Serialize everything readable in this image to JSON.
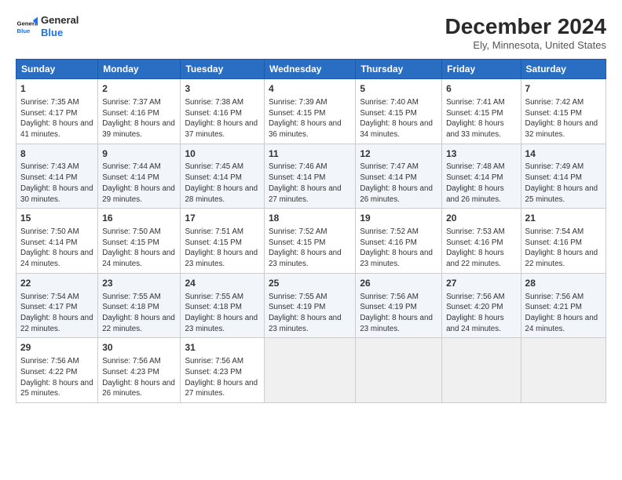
{
  "logo": {
    "line1": "General",
    "line2": "Blue"
  },
  "title": "December 2024",
  "location": "Ely, Minnesota, United States",
  "headers": [
    "Sunday",
    "Monday",
    "Tuesday",
    "Wednesday",
    "Thursday",
    "Friday",
    "Saturday"
  ],
  "weeks": [
    [
      {
        "day": "1",
        "sunrise": "7:35 AM",
        "sunset": "4:17 PM",
        "daylight": "8 hours and 41 minutes."
      },
      {
        "day": "2",
        "sunrise": "7:37 AM",
        "sunset": "4:16 PM",
        "daylight": "8 hours and 39 minutes."
      },
      {
        "day": "3",
        "sunrise": "7:38 AM",
        "sunset": "4:16 PM",
        "daylight": "8 hours and 37 minutes."
      },
      {
        "day": "4",
        "sunrise": "7:39 AM",
        "sunset": "4:15 PM",
        "daylight": "8 hours and 36 minutes."
      },
      {
        "day": "5",
        "sunrise": "7:40 AM",
        "sunset": "4:15 PM",
        "daylight": "8 hours and 34 minutes."
      },
      {
        "day": "6",
        "sunrise": "7:41 AM",
        "sunset": "4:15 PM",
        "daylight": "8 hours and 33 minutes."
      },
      {
        "day": "7",
        "sunrise": "7:42 AM",
        "sunset": "4:15 PM",
        "daylight": "8 hours and 32 minutes."
      }
    ],
    [
      {
        "day": "8",
        "sunrise": "7:43 AM",
        "sunset": "4:14 PM",
        "daylight": "8 hours and 30 minutes."
      },
      {
        "day": "9",
        "sunrise": "7:44 AM",
        "sunset": "4:14 PM",
        "daylight": "8 hours and 29 minutes."
      },
      {
        "day": "10",
        "sunrise": "7:45 AM",
        "sunset": "4:14 PM",
        "daylight": "8 hours and 28 minutes."
      },
      {
        "day": "11",
        "sunrise": "7:46 AM",
        "sunset": "4:14 PM",
        "daylight": "8 hours and 27 minutes."
      },
      {
        "day": "12",
        "sunrise": "7:47 AM",
        "sunset": "4:14 PM",
        "daylight": "8 hours and 26 minutes."
      },
      {
        "day": "13",
        "sunrise": "7:48 AM",
        "sunset": "4:14 PM",
        "daylight": "8 hours and 26 minutes."
      },
      {
        "day": "14",
        "sunrise": "7:49 AM",
        "sunset": "4:14 PM",
        "daylight": "8 hours and 25 minutes."
      }
    ],
    [
      {
        "day": "15",
        "sunrise": "7:50 AM",
        "sunset": "4:14 PM",
        "daylight": "8 hours and 24 minutes."
      },
      {
        "day": "16",
        "sunrise": "7:50 AM",
        "sunset": "4:15 PM",
        "daylight": "8 hours and 24 minutes."
      },
      {
        "day": "17",
        "sunrise": "7:51 AM",
        "sunset": "4:15 PM",
        "daylight": "8 hours and 23 minutes."
      },
      {
        "day": "18",
        "sunrise": "7:52 AM",
        "sunset": "4:15 PM",
        "daylight": "8 hours and 23 minutes."
      },
      {
        "day": "19",
        "sunrise": "7:52 AM",
        "sunset": "4:16 PM",
        "daylight": "8 hours and 23 minutes."
      },
      {
        "day": "20",
        "sunrise": "7:53 AM",
        "sunset": "4:16 PM",
        "daylight": "8 hours and 22 minutes."
      },
      {
        "day": "21",
        "sunrise": "7:54 AM",
        "sunset": "4:16 PM",
        "daylight": "8 hours and 22 minutes."
      }
    ],
    [
      {
        "day": "22",
        "sunrise": "7:54 AM",
        "sunset": "4:17 PM",
        "daylight": "8 hours and 22 minutes."
      },
      {
        "day": "23",
        "sunrise": "7:55 AM",
        "sunset": "4:18 PM",
        "daylight": "8 hours and 22 minutes."
      },
      {
        "day": "24",
        "sunrise": "7:55 AM",
        "sunset": "4:18 PM",
        "daylight": "8 hours and 23 minutes."
      },
      {
        "day": "25",
        "sunrise": "7:55 AM",
        "sunset": "4:19 PM",
        "daylight": "8 hours and 23 minutes."
      },
      {
        "day": "26",
        "sunrise": "7:56 AM",
        "sunset": "4:19 PM",
        "daylight": "8 hours and 23 minutes."
      },
      {
        "day": "27",
        "sunrise": "7:56 AM",
        "sunset": "4:20 PM",
        "daylight": "8 hours and 24 minutes."
      },
      {
        "day": "28",
        "sunrise": "7:56 AM",
        "sunset": "4:21 PM",
        "daylight": "8 hours and 24 minutes."
      }
    ],
    [
      {
        "day": "29",
        "sunrise": "7:56 AM",
        "sunset": "4:22 PM",
        "daylight": "8 hours and 25 minutes."
      },
      {
        "day": "30",
        "sunrise": "7:56 AM",
        "sunset": "4:23 PM",
        "daylight": "8 hours and 26 minutes."
      },
      {
        "day": "31",
        "sunrise": "7:56 AM",
        "sunset": "4:23 PM",
        "daylight": "8 hours and 27 minutes."
      },
      null,
      null,
      null,
      null
    ]
  ],
  "labels": {
    "sunrise": "Sunrise:",
    "sunset": "Sunset:",
    "daylight": "Daylight:"
  }
}
